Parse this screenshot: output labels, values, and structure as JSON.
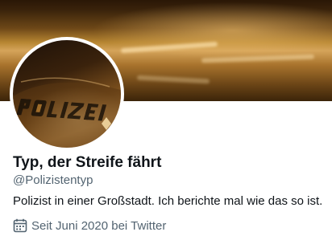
{
  "profile": {
    "name": "Typ, der Streife fährt",
    "handle": "@Polizistentyp",
    "bio": "Polizist in einer Großstadt. Ich berichte mal wie das so ist.",
    "joined": "Seit Juni 2020 bei Twitter",
    "joined_icon": "calendar-icon",
    "banner_image": "night-street-lights-photo",
    "avatar_image": "police-car-hood-photo",
    "avatar_lettering": "POLIZEI"
  },
  "colors": {
    "name_text": "#0f1419",
    "secondary_text": "#536471",
    "background": "#ffffff"
  }
}
